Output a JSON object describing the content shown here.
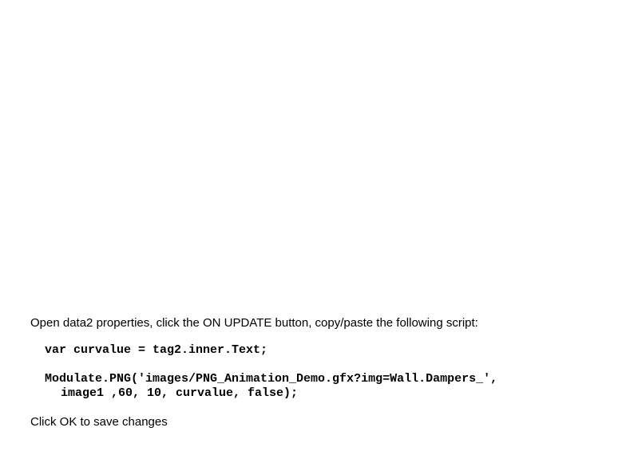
{
  "doc": {
    "intro": "Open data2 properties, click the ON UPDATE button, copy/paste the following script:",
    "code1": "var curvalue = tag2.inner.Text;",
    "code2": "Modulate.PNG('images/PNG_Animation_Demo.gfx?img=Wall.Dampers_',",
    "code3": "image1 ,60, 10, curvalue, false);",
    "outro": "Click OK to save changes"
  }
}
